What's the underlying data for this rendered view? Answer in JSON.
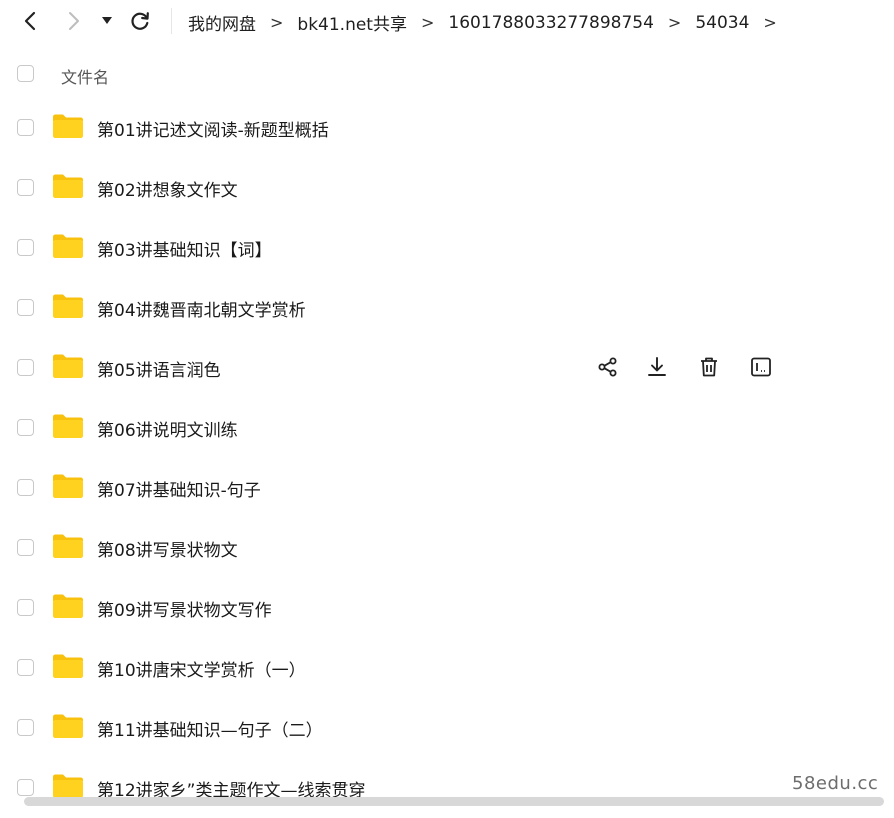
{
  "toolbar": {
    "breadcrumb": [
      "我的网盘",
      "bk41.net共享",
      "1601788033277898754",
      "54034"
    ],
    "separator": ">"
  },
  "list": {
    "header": "文件名",
    "items": [
      {
        "name": "第01讲记述文阅读-新题型概括"
      },
      {
        "name": "第02讲想象文作文"
      },
      {
        "name": "第03讲基础知识【词】"
      },
      {
        "name": "第04讲魏晋南北朝文学赏析"
      },
      {
        "name": "第05讲语言润色"
      },
      {
        "name": "第06讲说明文训练"
      },
      {
        "name": "第07讲基础知识-句子"
      },
      {
        "name": "第08讲写景状物文"
      },
      {
        "name": "第09讲写景状物文写作"
      },
      {
        "name": "第10讲唐宋文学赏析（一）"
      },
      {
        "name": "第11讲基础知识—句子（二）"
      },
      {
        "name": "第12讲家乡”类主题作文—线索贯穿"
      }
    ],
    "hover_row_index": 4,
    "hover_actions": [
      "share-icon",
      "download-icon",
      "delete-icon",
      "rename-icon"
    ]
  },
  "colors": {
    "folder": "#FFD21F",
    "folder_tab": "#F7C10E"
  },
  "watermark": "58edu.cc"
}
